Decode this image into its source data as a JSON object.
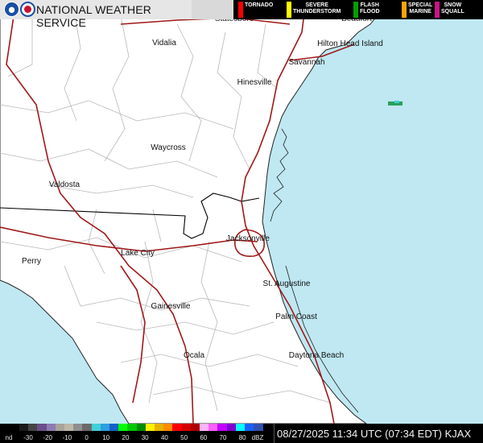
{
  "header": {
    "title": "NATIONAL WEATHER SERVICE",
    "noaa_logo_icon": "noaa-logo-icon",
    "nws_logo_icon": "nws-logo-icon"
  },
  "legend": [
    {
      "label": "TORNADO",
      "color": "#ff0000"
    },
    {
      "label": "SEVERE\nTHUNDERSTORM",
      "color": "#ffff00"
    },
    {
      "label": "FLASH\nFLOOD",
      "color": "#00a000"
    },
    {
      "label": "SPECIAL\nMARINE",
      "color": "#ffa500"
    },
    {
      "label": "SNOW\nSQUALL",
      "color": "#c71585"
    }
  ],
  "cities": {
    "statesboro": "Statesboro",
    "beaufort": "Beaufort",
    "vidalia": "Vidalia",
    "hilton_head": "Hilton Head Island",
    "savannah": "Savannah",
    "hinesville": "Hinesville",
    "waycross": "Waycross",
    "valdosta": "Valdosta",
    "jacksonville": "Jacksonville",
    "perry": "Perry",
    "lake_city": "Lake City",
    "st_augustine": "St. Augustine",
    "gainesville": "Gainesville",
    "palm_coast": "Palm Coast",
    "ocala": "Ocala",
    "daytona_beach": "Daytona Beach"
  },
  "scale": {
    "unit_left": "nd",
    "unit_right": "dBZ",
    "ticks": [
      "-30",
      "-20",
      "-10",
      "0",
      "10",
      "20",
      "30",
      "40",
      "50",
      "60",
      "70",
      "80"
    ],
    "colors": [
      "#000000",
      "#1a1a1a",
      "#444444",
      "#6a4e8a",
      "#8d7ab0",
      "#a9a39a",
      "#bdb8a8",
      "#8f8f8f",
      "#6a6a6a",
      "#3fd0d8",
      "#2aa0e0",
      "#1560c8",
      "#00ff00",
      "#00c800",
      "#008c00",
      "#fff000",
      "#e6b400",
      "#ff8c00",
      "#ff0000",
      "#d40000",
      "#b00000",
      "#ffb4ff",
      "#ff60ff",
      "#c000ff",
      "#8000d0",
      "#00ffff",
      "#1a60ff",
      "#3050b0"
    ]
  },
  "timestamp": "08/27/2025 11:34 UTC (07:34 EDT)  KJAX",
  "colors": {
    "ocean": "#bfe8f2",
    "land": "#ffffff",
    "highway": "#a01818",
    "county_line": "#b8b8b8",
    "state_line": "#000000"
  }
}
